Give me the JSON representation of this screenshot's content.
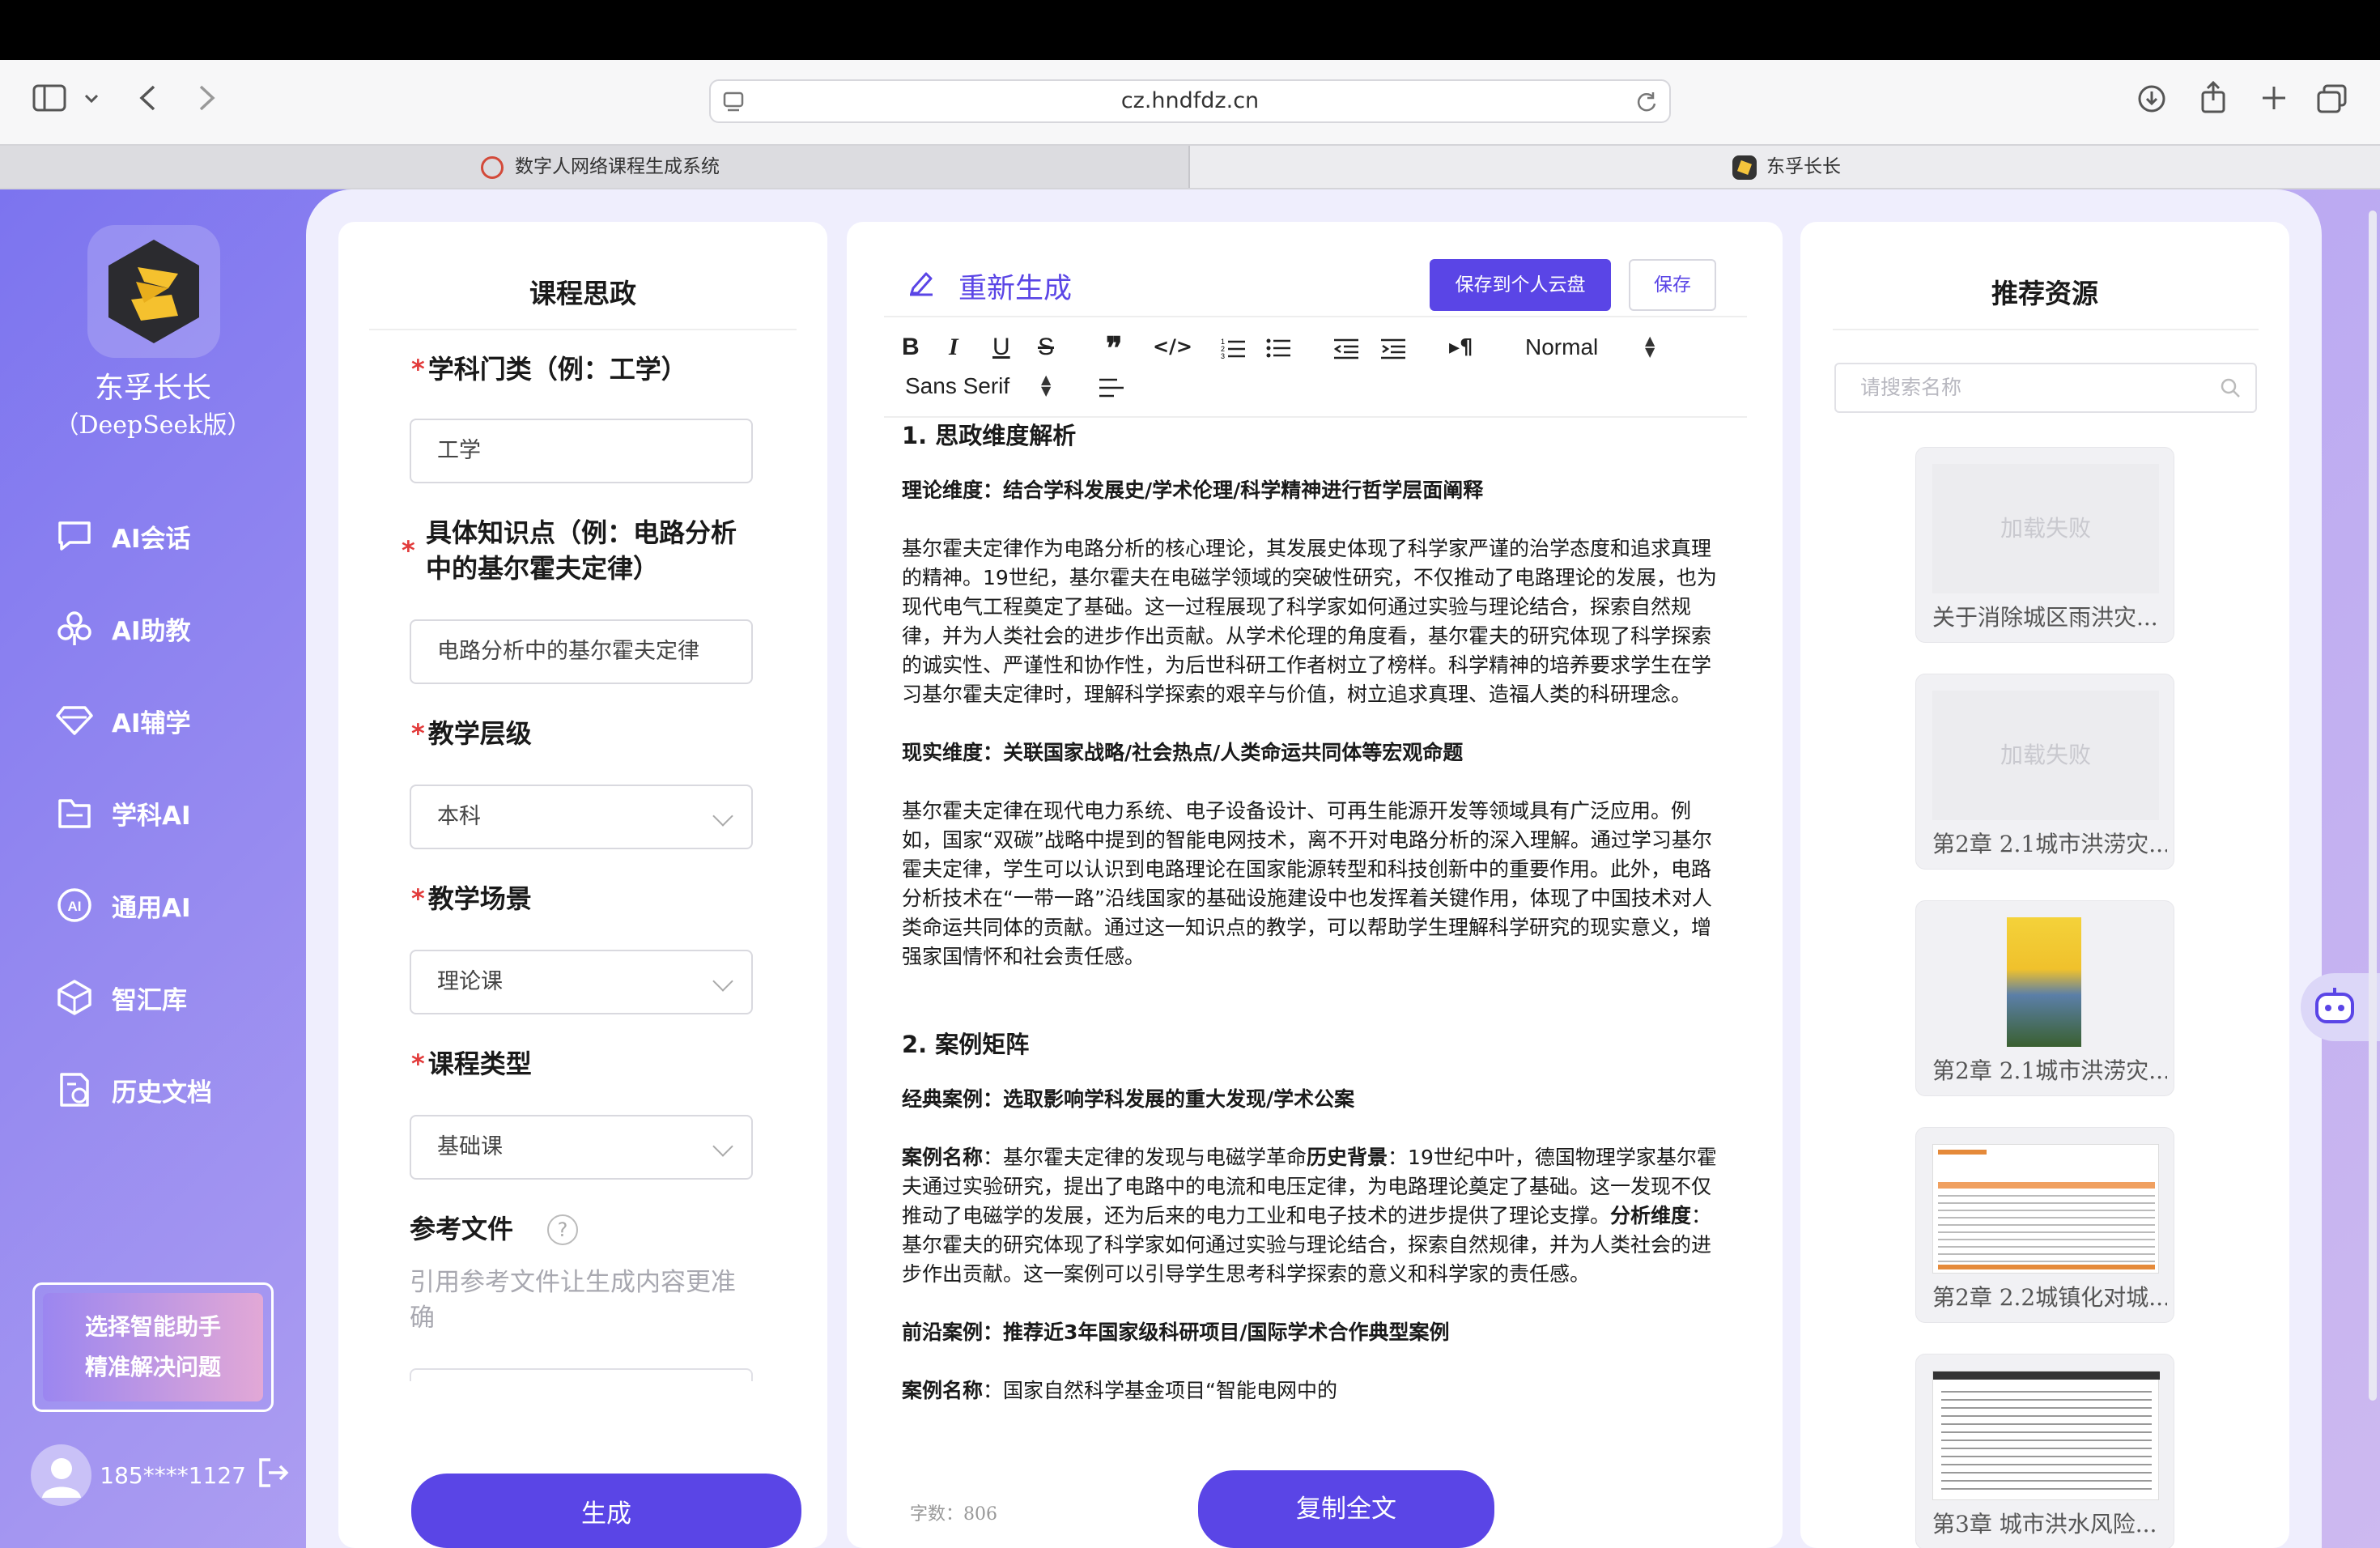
{
  "browser": {
    "url": "cz.hndfdz.cn",
    "tabs": [
      {
        "label": "数字人网络课程生成系统"
      },
      {
        "label": "东孚长长"
      }
    ]
  },
  "sidebar": {
    "brand": "东孚长长",
    "brand_sub": "（DeepSeek版）",
    "items": [
      {
        "label": "AI会话",
        "icon": "chat-icon"
      },
      {
        "label": "AI助教",
        "icon": "assistant-icon"
      },
      {
        "label": "AI辅学",
        "icon": "diamond-icon"
      },
      {
        "label": "学科AI",
        "icon": "folder-icon"
      },
      {
        "label": "通用AI",
        "icon": "ai-badge-icon"
      },
      {
        "label": "智汇库",
        "icon": "cube-icon"
      },
      {
        "label": "历史文档",
        "icon": "document-icon"
      }
    ],
    "promo": {
      "line1": "选择智能助手",
      "line2": "精准解决问题"
    },
    "user": {
      "phone": "185****1127"
    }
  },
  "form": {
    "title": "课程思政",
    "fields": [
      {
        "label": "学科门类（例：工学）",
        "value": "工学"
      },
      {
        "label_line1": "具体知识点（例：电路分析",
        "label_line2": "中的基尔霍夫定律）",
        "value": "电路分析中的基尔霍夫定律"
      },
      {
        "label": "教学层级",
        "value": "本科"
      },
      {
        "label": "教学场景",
        "value": "理论课"
      },
      {
        "label": "课程类型",
        "value": "基础课"
      }
    ],
    "ref_label": "参考文件",
    "ref_hint_line1": "引用参考文件让生成内容更准",
    "ref_hint_line2": "确",
    "generate": "生成"
  },
  "editor": {
    "regenerate": "重新生成",
    "save_cloud": "保存到个人云盘",
    "save": "保存",
    "toolbar": {
      "normal": "Normal",
      "font": "Sans Serif"
    },
    "content": {
      "h1": "1. 思政维度解析",
      "sub1": "理论维度：结合学科发展史/学术伦理/科学精神进行哲学层面阐释",
      "p1": "基尔霍夫定律作为电路分析的核心理论，其发展史体现了科学家严谨的治学态度和追求真理的精神。19世纪，基尔霍夫在电磁学领域的突破性研究，不仅推动了电路理论的发展，也为现代电气工程奠定了基础。这一过程展现了科学家如何通过实验与理论结合，探索自然规律，并为人类社会的进步作出贡献。从学术伦理的角度看，基尔霍夫的研究体现了科学探索的诚实性、严谨性和协作性，为后世科研工作者树立了榜样。科学精神的培养要求学生在学习基尔霍夫定律时，理解科学探索的艰辛与价值，树立追求真理、造福人类的科研理念。",
      "sub2": "现实维度：关联国家战略/社会热点/人类命运共同体等宏观命题",
      "p2": "基尔霍夫定律在现代电力系统、电子设备设计、可再生能源开发等领域具有广泛应用。例如，国家“双碳”战略中提到的智能电网技术，离不开对电路分析的深入理解。通过学习基尔霍夫定律，学生可以认识到电路理论在国家能源转型和科技创新中的重要作用。此外，电路分析技术在“一带一路”沿线国家的基础设施建设中也发挥着关键作用，体现了中国技术对人类命运共同体的贡献。通过这一知识点的教学，可以帮助学生理解科学研究的现实意义，增强家国情怀和社会责任感。",
      "h2": "2. 案例矩阵",
      "sub3": "经典案例：选取影响学科发展的重大发现/学术公案",
      "p3_a": "案例名称",
      "p3_b": "：基尔霍夫定律的发现与电磁学革命",
      "p3_c": "历史背景",
      "p3_d": "：19世纪中叶，德国物理学家基尔霍夫通过实验研究，提出了电路中的电流和电压定律，为电路理论奠定了基础。这一发现不仅推动了电磁学的发展，还为后来的电力工业和电子技术的进步提供了理论支撑。",
      "p3_e": "分析维度",
      "p3_f": "：基尔霍夫的研究体现了科学家如何通过实验与理论结合，探索自然规律，并为人类社会的进步作出贡献。这一案例可以引导学生思考科学探索的意义和科学家的责任感。",
      "sub4": "前沿案例：推荐近3年国家级科研项目/国际学术合作典型案例",
      "p4_a": "案例名称",
      "p4_b": "：国家自然科学基金项目“智能电网中的"
    },
    "word_count": "字数：806",
    "copy_all": "复制全文"
  },
  "resources": {
    "title": "推荐资源",
    "search_placeholder": "请搜索名称",
    "load_failed": "加载失败",
    "items": [
      {
        "title": "关于消除城区雨洪灾..."
      },
      {
        "title": "第2章 2.1城市洪涝灾..."
      },
      {
        "title": "第2章 2.1城市洪涝灾..."
      },
      {
        "title": "第2章 2.2城镇化对城..."
      },
      {
        "title": "第3章 城市洪水风险..."
      }
    ]
  }
}
